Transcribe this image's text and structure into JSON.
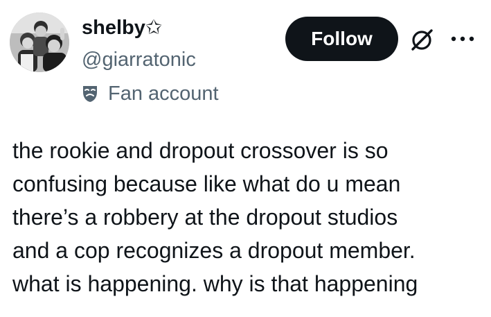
{
  "author": {
    "display_name": "shelby",
    "badge_glyph": "✩",
    "handle": "@giarratonic",
    "label_icon": "theater-mask-icon",
    "label": "Fan account"
  },
  "actions": {
    "follow_label": "Follow",
    "grok_icon": "grok-icon",
    "more_icon": "more-icon"
  },
  "tweet": {
    "lines": [
      "the rookie and dropout crossover is so",
      "confusing because like what do u mean",
      "there’s a robbery at the dropout studios",
      "and a cop recognizes a dropout member.",
      "what is happening. why is that happening"
    ]
  },
  "colors": {
    "text_primary": "#0f1419",
    "text_secondary": "#536471",
    "follow_bg": "#0f1419",
    "follow_text": "#ffffff",
    "background": "#ffffff"
  }
}
